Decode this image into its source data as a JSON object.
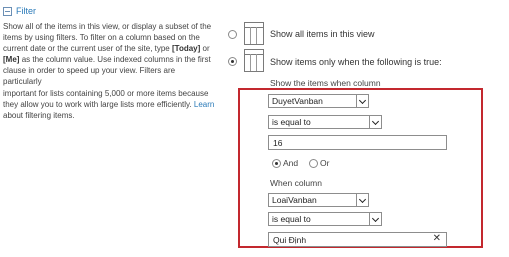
{
  "filter_section": {
    "title": "Filter",
    "description_lines": [
      "Show all of the items in this view, or display a subset of the",
      "items by using filters. To filter on a column based on the",
      "current date or the current user of the site, type",
      "as the column value. Use indexed columns in the first",
      "clause in order to speed up your view. Filters are particularly",
      "important for lists containing 5,000 or more items because",
      "they allow you to work with large lists more efficiently.",
      "about filtering items."
    ],
    "today_token": "[Today]",
    "or_text": " or",
    "me_token": "[Me]",
    "learn_link": "Learn"
  },
  "options": {
    "show_all": "Show all items in this view",
    "show_filtered": "Show items only when the following is true:",
    "selected": "show_filtered"
  },
  "criteria": {
    "heading": "Show the items when column",
    "column1": "DuyetVanban",
    "operator1": "is equal to",
    "value1": "16",
    "and_label": "And",
    "or_label": "Or",
    "join_selected": "And",
    "when_column": "When column",
    "column2": "LoaiVanban",
    "operator2": "is equal to",
    "value2": "Qui Định",
    "clear_glyph": "✕"
  },
  "colors": {
    "highlight_frame": "#c3282e",
    "link": "#2a7ab8"
  }
}
